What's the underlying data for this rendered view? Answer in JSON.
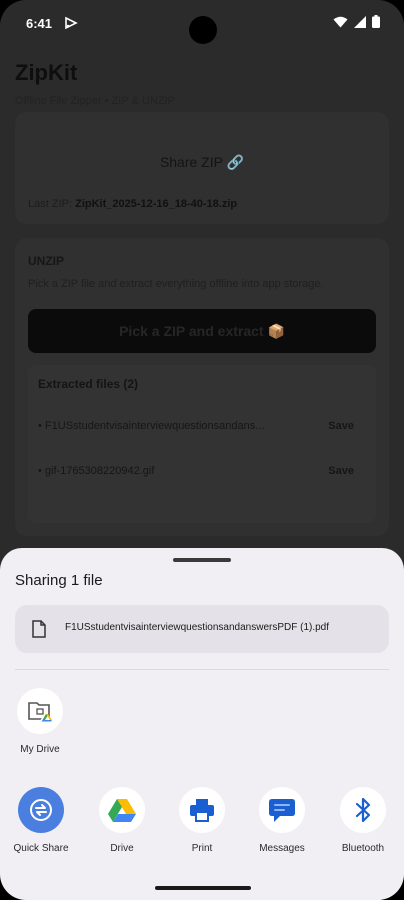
{
  "status_bar": {
    "time": "6:41"
  },
  "app": {
    "title": "ZipKit",
    "subtitle": "Offline File Zipper • ZIP & UNZIP",
    "share_zip": "Share ZIP 🔗",
    "last_zip_label": "Last ZIP:",
    "last_zip_value": "ZipKit_2025-12-16_18-40-18.zip",
    "unzip_heading": "UNZIP",
    "unzip_desc": "Pick a ZIP file and extract everything offline into app storage.",
    "pick_button": "Pick a ZIP and extract 📦",
    "extracted_heading": "Extracted files (2)",
    "files": [
      {
        "name": "• F1USstudentvisainterviewquestionsandans...",
        "action": "Save"
      },
      {
        "name": "• gif-1765308220942.gif",
        "action": "Save"
      }
    ]
  },
  "sheet": {
    "title": "Sharing 1 file",
    "file_name": "F1USstudentvisainterviewquestionsandanswersPDF (1).pdf",
    "recent": [
      {
        "label": "My Drive",
        "icon": "drive-folder-icon"
      }
    ],
    "apps": [
      {
        "label": "Quick Share",
        "icon": "quick-share-icon",
        "color": "#4a7fe0"
      },
      {
        "label": "Drive",
        "icon": "google-drive-icon"
      },
      {
        "label": "Print",
        "icon": "print-icon",
        "color": "#1a5fd1"
      },
      {
        "label": "Messages",
        "icon": "messages-icon",
        "color": "#1a5fd1"
      },
      {
        "label": "Bluetooth",
        "icon": "bluetooth-icon",
        "color": "#1a5fd1"
      }
    ]
  }
}
